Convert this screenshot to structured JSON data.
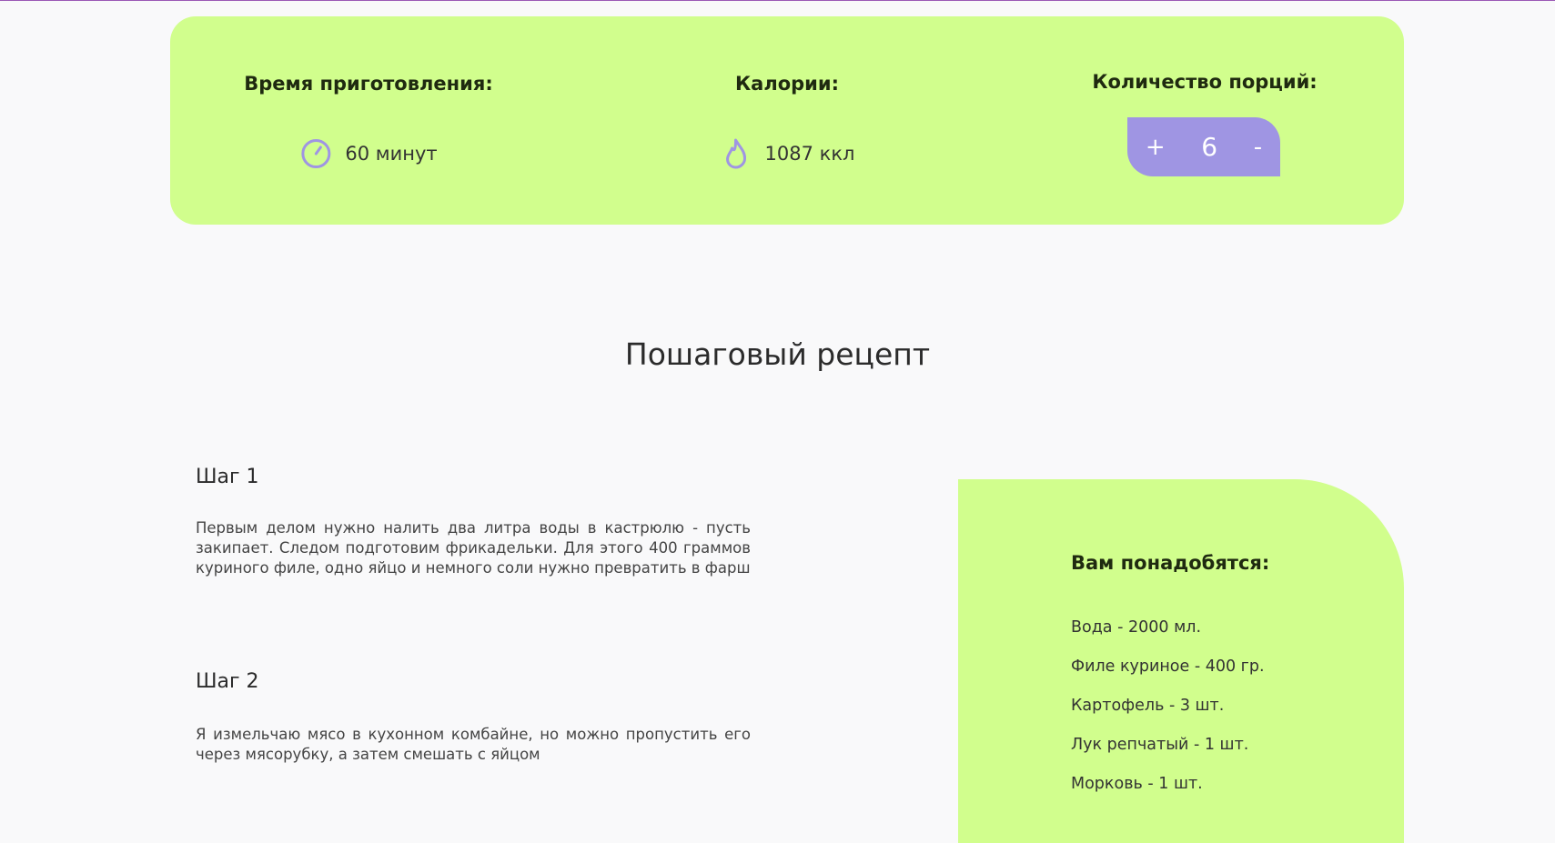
{
  "info": {
    "time_title": "Время приготовления:",
    "time_value": "60 минут",
    "time_icon": "timer-icon",
    "calories_title": "Калории:",
    "calories_value": "1087 ккл",
    "calories_icon": "flame-icon",
    "servings_title": "Количество порций:",
    "servings_plus": "+",
    "servings_count": "6",
    "servings_minus": "-"
  },
  "recipe": {
    "title": "Пошаговый рецепт",
    "steps": [
      {
        "title": "Шаг 1",
        "text": "Первым делом нужно налить два литра воды в кастрюлю - пусть закипает. Следом подготовим фрикадельки. Для этого 400 граммов куриного филе, одно яйцо и немного соли нужно превратить в фарш"
      },
      {
        "title": "Шаг 2",
        "text": "Я измельчаю мясо в кухонном комбайне, но можно пропустить его через мясорубку, а затем смешать с яйцом"
      }
    ]
  },
  "ingredients": {
    "title": "Вам понадобятся:",
    "items": [
      "Вода - 2000 мл.",
      "Филе куриное - 400 гр.",
      "Картофель - 3 шт.",
      "Лук репчатый - 1 шт.",
      "Морковь - 1 шт."
    ]
  },
  "colors": {
    "card_green": "#d1fe8d",
    "accent_purple": "#9f95e3",
    "background": "#f9f9fa"
  }
}
